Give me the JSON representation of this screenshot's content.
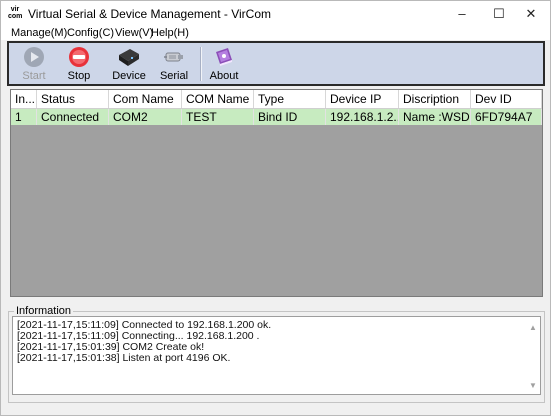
{
  "window": {
    "icon_text": "vir\ncom",
    "title": "Virtual Serial & Device Management - VirCom",
    "controls": {
      "minimize": "–",
      "maximize": "☐",
      "close": "✕"
    }
  },
  "menu": [
    "Manage(M)",
    "Config(C)",
    "View(V)",
    "Help(H)"
  ],
  "toolbar": {
    "buttons": [
      {
        "label": "Start",
        "icon": "play-icon",
        "enabled": false
      },
      {
        "label": "Stop",
        "icon": "stop-icon",
        "enabled": true
      },
      {
        "label": "Device",
        "icon": "device-icon",
        "enabled": true
      },
      {
        "label": "Serial",
        "icon": "serial-icon",
        "enabled": true
      },
      {
        "label": "About",
        "icon": "about-icon",
        "enabled": true
      }
    ]
  },
  "table": {
    "columns": [
      "In...",
      "Status",
      "Com Name",
      "COM Name",
      "Type",
      "Device IP",
      "Discription",
      "Dev ID"
    ],
    "rows": [
      [
        "1",
        "Connected",
        "COM2",
        "TEST",
        "Bind ID",
        "192.168.1.2...",
        "Name :WSD...",
        "6FD794A7"
      ]
    ],
    "row_color": "#c7ebc0"
  },
  "info": {
    "legend": "Information",
    "log": [
      "[2021-11-17,15:11:09] Connected to 192.168.1.200 ok.",
      "[2021-11-17,15:11:09] Connecting... 192.168.1.200 .",
      "[2021-11-17,15:01:39] COM2 Create ok!",
      "[2021-11-17,15:01:38] Listen at port 4196 OK."
    ]
  }
}
